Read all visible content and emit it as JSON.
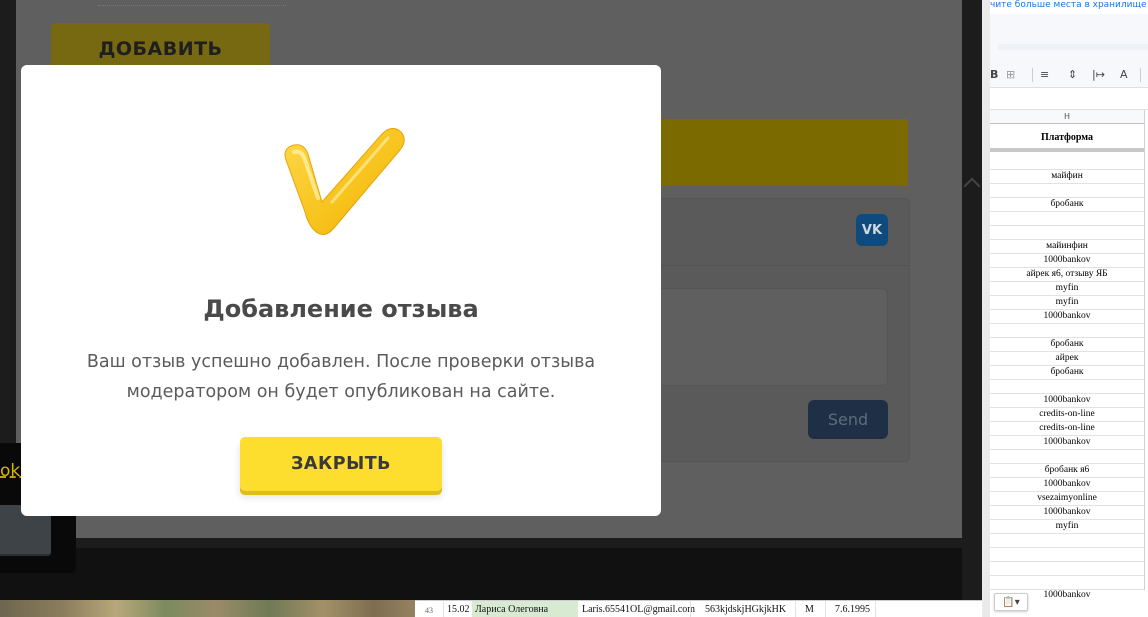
{
  "site": {
    "add_button": "ДОБАВИТЬ",
    "send_button": "Send",
    "vk_icon": "VK",
    "cookie_text": "okie"
  },
  "modal": {
    "title": "Добавление отзыва",
    "message": "Ваш отзыв успешно добавлен. После проверки отзыва модератором он будет опубликован на сайте.",
    "close_button": "ЗАКРЫТЬ",
    "icon": "checkmark-icon",
    "accent_color": "#fddd2e"
  },
  "spreadsheet": {
    "storage_notice": "чите больше места в хранилище — со",
    "toolbar": {
      "bold": "B",
      "merge": "⊞",
      "align": "≡",
      "valign": "⇕",
      "wrap": "|↦",
      "text_color": "A"
    },
    "column_letter": "H",
    "column_header": "Платформа",
    "cells": [
      "",
      "майфин",
      "",
      "бробанк",
      "",
      "",
      "майинфин",
      "1000bankov",
      "айрек я6, отзыву ЯБ",
      "myfin",
      "myfin",
      "1000bankov",
      "",
      "бробанк",
      "айрек",
      "бробанк",
      "",
      "1000bankov",
      "credits-on-line",
      "credits-on-line",
      "1000bankov",
      "",
      "бробанк я6",
      "1000bankov",
      "vsezaimyonline",
      "1000bankov",
      "myfin",
      "",
      "",
      "",
      ""
    ],
    "bottom_cell": "1000bankov",
    "paste_icon": "clipboard-icon"
  },
  "bottom_row": {
    "row_number": "43",
    "date": "15.02",
    "name": "Лариса Олеговна",
    "email": "Laris.65541OL@gmail.com",
    "password": "563kjdskjHGkjkHK",
    "gender": "М",
    "birthdate": "7.6.1995"
  }
}
